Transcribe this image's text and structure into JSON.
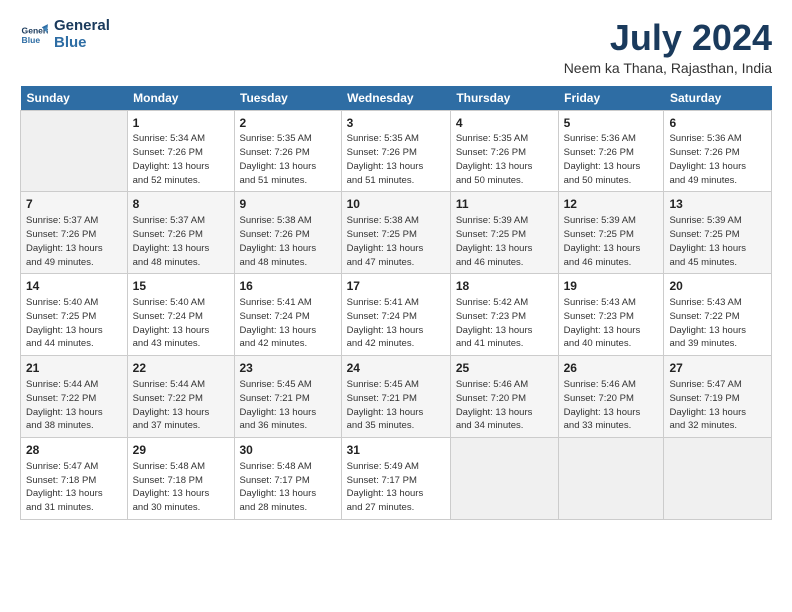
{
  "header": {
    "logo_line1": "General",
    "logo_line2": "Blue",
    "title": "July 2024",
    "location": "Neem ka Thana, Rajasthan, India"
  },
  "days_of_week": [
    "Sunday",
    "Monday",
    "Tuesday",
    "Wednesday",
    "Thursday",
    "Friday",
    "Saturday"
  ],
  "weeks": [
    [
      {
        "num": "",
        "info": ""
      },
      {
        "num": "1",
        "info": "Sunrise: 5:34 AM\nSunset: 7:26 PM\nDaylight: 13 hours\nand 52 minutes."
      },
      {
        "num": "2",
        "info": "Sunrise: 5:35 AM\nSunset: 7:26 PM\nDaylight: 13 hours\nand 51 minutes."
      },
      {
        "num": "3",
        "info": "Sunrise: 5:35 AM\nSunset: 7:26 PM\nDaylight: 13 hours\nand 51 minutes."
      },
      {
        "num": "4",
        "info": "Sunrise: 5:35 AM\nSunset: 7:26 PM\nDaylight: 13 hours\nand 50 minutes."
      },
      {
        "num": "5",
        "info": "Sunrise: 5:36 AM\nSunset: 7:26 PM\nDaylight: 13 hours\nand 50 minutes."
      },
      {
        "num": "6",
        "info": "Sunrise: 5:36 AM\nSunset: 7:26 PM\nDaylight: 13 hours\nand 49 minutes."
      }
    ],
    [
      {
        "num": "7",
        "info": "Sunrise: 5:37 AM\nSunset: 7:26 PM\nDaylight: 13 hours\nand 49 minutes."
      },
      {
        "num": "8",
        "info": "Sunrise: 5:37 AM\nSunset: 7:26 PM\nDaylight: 13 hours\nand 48 minutes."
      },
      {
        "num": "9",
        "info": "Sunrise: 5:38 AM\nSunset: 7:26 PM\nDaylight: 13 hours\nand 48 minutes."
      },
      {
        "num": "10",
        "info": "Sunrise: 5:38 AM\nSunset: 7:25 PM\nDaylight: 13 hours\nand 47 minutes."
      },
      {
        "num": "11",
        "info": "Sunrise: 5:39 AM\nSunset: 7:25 PM\nDaylight: 13 hours\nand 46 minutes."
      },
      {
        "num": "12",
        "info": "Sunrise: 5:39 AM\nSunset: 7:25 PM\nDaylight: 13 hours\nand 46 minutes."
      },
      {
        "num": "13",
        "info": "Sunrise: 5:39 AM\nSunset: 7:25 PM\nDaylight: 13 hours\nand 45 minutes."
      }
    ],
    [
      {
        "num": "14",
        "info": "Sunrise: 5:40 AM\nSunset: 7:25 PM\nDaylight: 13 hours\nand 44 minutes."
      },
      {
        "num": "15",
        "info": "Sunrise: 5:40 AM\nSunset: 7:24 PM\nDaylight: 13 hours\nand 43 minutes."
      },
      {
        "num": "16",
        "info": "Sunrise: 5:41 AM\nSunset: 7:24 PM\nDaylight: 13 hours\nand 42 minutes."
      },
      {
        "num": "17",
        "info": "Sunrise: 5:41 AM\nSunset: 7:24 PM\nDaylight: 13 hours\nand 42 minutes."
      },
      {
        "num": "18",
        "info": "Sunrise: 5:42 AM\nSunset: 7:23 PM\nDaylight: 13 hours\nand 41 minutes."
      },
      {
        "num": "19",
        "info": "Sunrise: 5:43 AM\nSunset: 7:23 PM\nDaylight: 13 hours\nand 40 minutes."
      },
      {
        "num": "20",
        "info": "Sunrise: 5:43 AM\nSunset: 7:22 PM\nDaylight: 13 hours\nand 39 minutes."
      }
    ],
    [
      {
        "num": "21",
        "info": "Sunrise: 5:44 AM\nSunset: 7:22 PM\nDaylight: 13 hours\nand 38 minutes."
      },
      {
        "num": "22",
        "info": "Sunrise: 5:44 AM\nSunset: 7:22 PM\nDaylight: 13 hours\nand 37 minutes."
      },
      {
        "num": "23",
        "info": "Sunrise: 5:45 AM\nSunset: 7:21 PM\nDaylight: 13 hours\nand 36 minutes."
      },
      {
        "num": "24",
        "info": "Sunrise: 5:45 AM\nSunset: 7:21 PM\nDaylight: 13 hours\nand 35 minutes."
      },
      {
        "num": "25",
        "info": "Sunrise: 5:46 AM\nSunset: 7:20 PM\nDaylight: 13 hours\nand 34 minutes."
      },
      {
        "num": "26",
        "info": "Sunrise: 5:46 AM\nSunset: 7:20 PM\nDaylight: 13 hours\nand 33 minutes."
      },
      {
        "num": "27",
        "info": "Sunrise: 5:47 AM\nSunset: 7:19 PM\nDaylight: 13 hours\nand 32 minutes."
      }
    ],
    [
      {
        "num": "28",
        "info": "Sunrise: 5:47 AM\nSunset: 7:18 PM\nDaylight: 13 hours\nand 31 minutes."
      },
      {
        "num": "29",
        "info": "Sunrise: 5:48 AM\nSunset: 7:18 PM\nDaylight: 13 hours\nand 30 minutes."
      },
      {
        "num": "30",
        "info": "Sunrise: 5:48 AM\nSunset: 7:17 PM\nDaylight: 13 hours\nand 28 minutes."
      },
      {
        "num": "31",
        "info": "Sunrise: 5:49 AM\nSunset: 7:17 PM\nDaylight: 13 hours\nand 27 minutes."
      },
      {
        "num": "",
        "info": ""
      },
      {
        "num": "",
        "info": ""
      },
      {
        "num": "",
        "info": ""
      }
    ]
  ]
}
